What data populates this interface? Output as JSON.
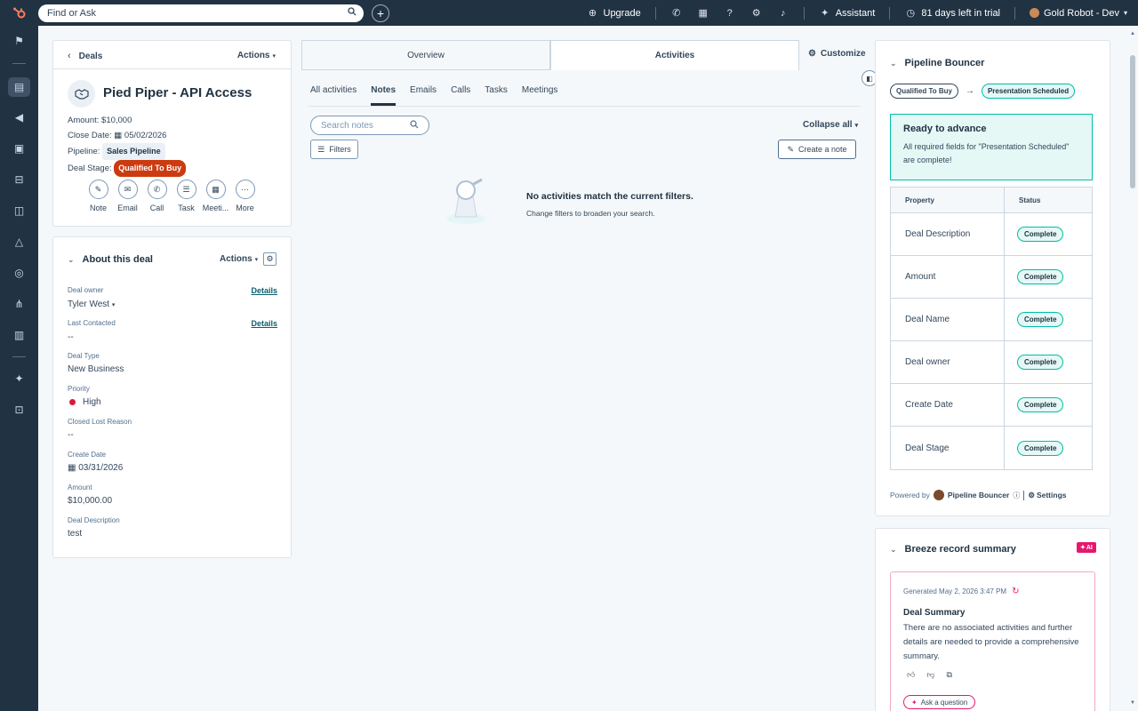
{
  "topbar": {
    "search_placeholder": "Find or Ask",
    "upgrade": "Upgrade",
    "assistant": "Assistant",
    "trial": "81 days left in trial",
    "account": "Gold Robot - Dev"
  },
  "record": {
    "back": "Deals",
    "actions": "Actions",
    "title": "Pied Piper - API Access",
    "amount_label": "Amount:",
    "amount_value": "$10,000",
    "close_label": "Close Date:",
    "close_value": "05/02/2026",
    "pipeline_label": "Pipeline:",
    "pipeline_value": "Sales Pipeline",
    "stage_label": "Deal Stage:",
    "stage_value": "Qualified To Buy",
    "activity_buttons": [
      "Note",
      "Email",
      "Call",
      "Task",
      "Meeti...",
      "More"
    ]
  },
  "about": {
    "title": "About this deal",
    "actions": "Actions",
    "details": "Details",
    "deal_owner_label": "Deal owner",
    "deal_owner_value": "Tyler West",
    "last_contacted_label": "Last Contacted",
    "last_contacted_value": "--",
    "deal_type_label": "Deal Type",
    "deal_type_value": "New Business",
    "priority_label": "Priority",
    "priority_value": "High",
    "closed_lost_label": "Closed Lost Reason",
    "closed_lost_value": "--",
    "create_date_label": "Create Date",
    "create_date_value": "03/31/2026",
    "amount_label": "Amount",
    "amount_value": "$10,000.00",
    "desc_label": "Deal Description",
    "desc_value": "test"
  },
  "center": {
    "tabs": [
      "Overview",
      "Activities"
    ],
    "customize": "Customize",
    "subtabs": [
      "All activities",
      "Notes",
      "Emails",
      "Calls",
      "Tasks",
      "Meetings"
    ],
    "search_placeholder": "Search notes",
    "collapse": "Collapse all",
    "filters": "Filters",
    "create_note": "Create a note",
    "empty_title": "No activities match the current filters.",
    "empty_sub": "Change filters to broaden your search."
  },
  "bouncer": {
    "title": "Pipeline Bouncer",
    "from_stage": "Qualified To Buy",
    "to_stage": "Presentation Scheduled",
    "ready_title": "Ready to advance",
    "ready_text": "All required fields for \"Presentation Scheduled\" are complete!",
    "col_property": "Property",
    "col_status": "Status",
    "rows": [
      {
        "property": "Deal Description",
        "status": "Complete"
      },
      {
        "property": "Amount",
        "status": "Complete"
      },
      {
        "property": "Deal Name",
        "status": "Complete"
      },
      {
        "property": "Deal owner",
        "status": "Complete"
      },
      {
        "property": "Create Date",
        "status": "Complete"
      },
      {
        "property": "Deal Stage",
        "status": "Complete"
      }
    ],
    "powered_by": "Powered by",
    "brand": "Pipeline Bouncer",
    "settings": "Settings"
  },
  "breeze": {
    "title": "Breeze record summary",
    "ai_badge": "AI",
    "generated": "Generated May 2, 2026 3:47 PM",
    "summary_title": "Deal Summary",
    "summary_text": "There are no associated activities and further details are needed to provide a comprehensive summary.",
    "ask": "Ask a question"
  },
  "colors": {
    "nav_bg": "#213343",
    "accent": "#0b5e6f",
    "stage_red": "#cc3b10",
    "success": "#00bda5",
    "ai_pink": "#e5186d"
  }
}
